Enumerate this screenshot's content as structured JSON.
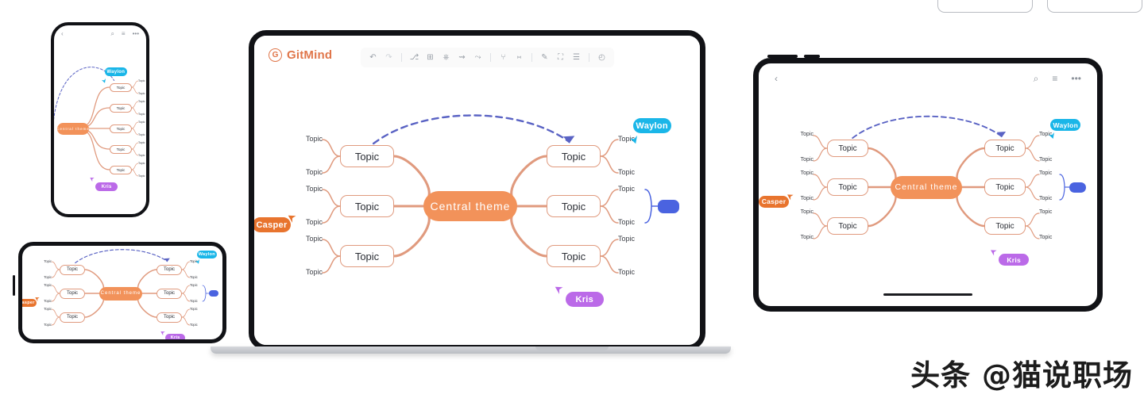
{
  "app": {
    "brand": "GitMind",
    "brand_mark": "G",
    "accent": "#e0764a",
    "central_color": "#f2925a",
    "node_border": "#e09a7e",
    "branch_color": "#e09a7e",
    "link_arrow_color": "#5a63c4"
  },
  "toolbar": {
    "items": [
      {
        "name": "undo-icon",
        "glyph": "↶",
        "state": "enabled"
      },
      {
        "name": "redo-icon",
        "glyph": "↷",
        "state": "disabled"
      },
      {
        "name": "separator",
        "glyph": "",
        "state": "static"
      },
      {
        "name": "insert-sibling-topic-icon",
        "glyph": "⎇",
        "state": "enabled"
      },
      {
        "name": "insert-child-topic-icon",
        "glyph": "⊞",
        "state": "enabled"
      },
      {
        "name": "insert-parent-topic-icon",
        "glyph": "⎈",
        "state": "enabled"
      },
      {
        "name": "insert-relation-icon",
        "glyph": "⇝",
        "state": "enabled"
      },
      {
        "name": "insert-summary-icon",
        "glyph": "⤳",
        "state": "enabled"
      },
      {
        "name": "separator",
        "glyph": "",
        "state": "static"
      },
      {
        "name": "layout-structure-icon",
        "glyph": "⑂",
        "state": "enabled"
      },
      {
        "name": "boundary-icon",
        "glyph": "⑅",
        "state": "enabled"
      },
      {
        "name": "separator",
        "glyph": "",
        "state": "static"
      },
      {
        "name": "pen-style-icon",
        "glyph": "✎",
        "state": "enabled"
      },
      {
        "name": "insert-image-icon",
        "glyph": "⛶",
        "state": "enabled"
      },
      {
        "name": "note-icon",
        "glyph": "☰",
        "state": "enabled"
      },
      {
        "name": "separator",
        "glyph": "",
        "state": "static"
      },
      {
        "name": "history-icon",
        "glyph": "◴",
        "state": "enabled"
      }
    ]
  },
  "mindmap": {
    "central_label": "Central theme",
    "topic_label": "Topic",
    "leaf_label": "Topic",
    "main_branch_count": 6,
    "leaf_per_branch": 2,
    "collaborators": [
      {
        "name": "Waylon",
        "color": "#1ab6e8"
      },
      {
        "name": "Kris",
        "color": "#bb6ae8"
      },
      {
        "name": "Casper",
        "color": "#e8742e"
      }
    ],
    "selection_box_color": "#4a63e0",
    "relation_style": "dashed-arc-arrow"
  },
  "phone": {
    "nav": {
      "back": {
        "name": "back-chevron-icon",
        "glyph": "‹"
      },
      "search": {
        "name": "search-icon",
        "glyph": "⌕"
      },
      "list": {
        "name": "list-icon",
        "glyph": "≡"
      },
      "more": {
        "name": "more-icon",
        "glyph": "•••"
      }
    },
    "branch_count": 5
  },
  "tablet": {
    "nav": {
      "back": {
        "name": "back-chevron-icon",
        "glyph": "‹"
      },
      "search": {
        "name": "search-icon",
        "glyph": "⌕"
      },
      "list": {
        "name": "list-icon",
        "glyph": "≡"
      },
      "more": {
        "name": "more-icon",
        "glyph": "•••"
      }
    }
  },
  "watermark": {
    "text": "头条 @猫说职场"
  }
}
